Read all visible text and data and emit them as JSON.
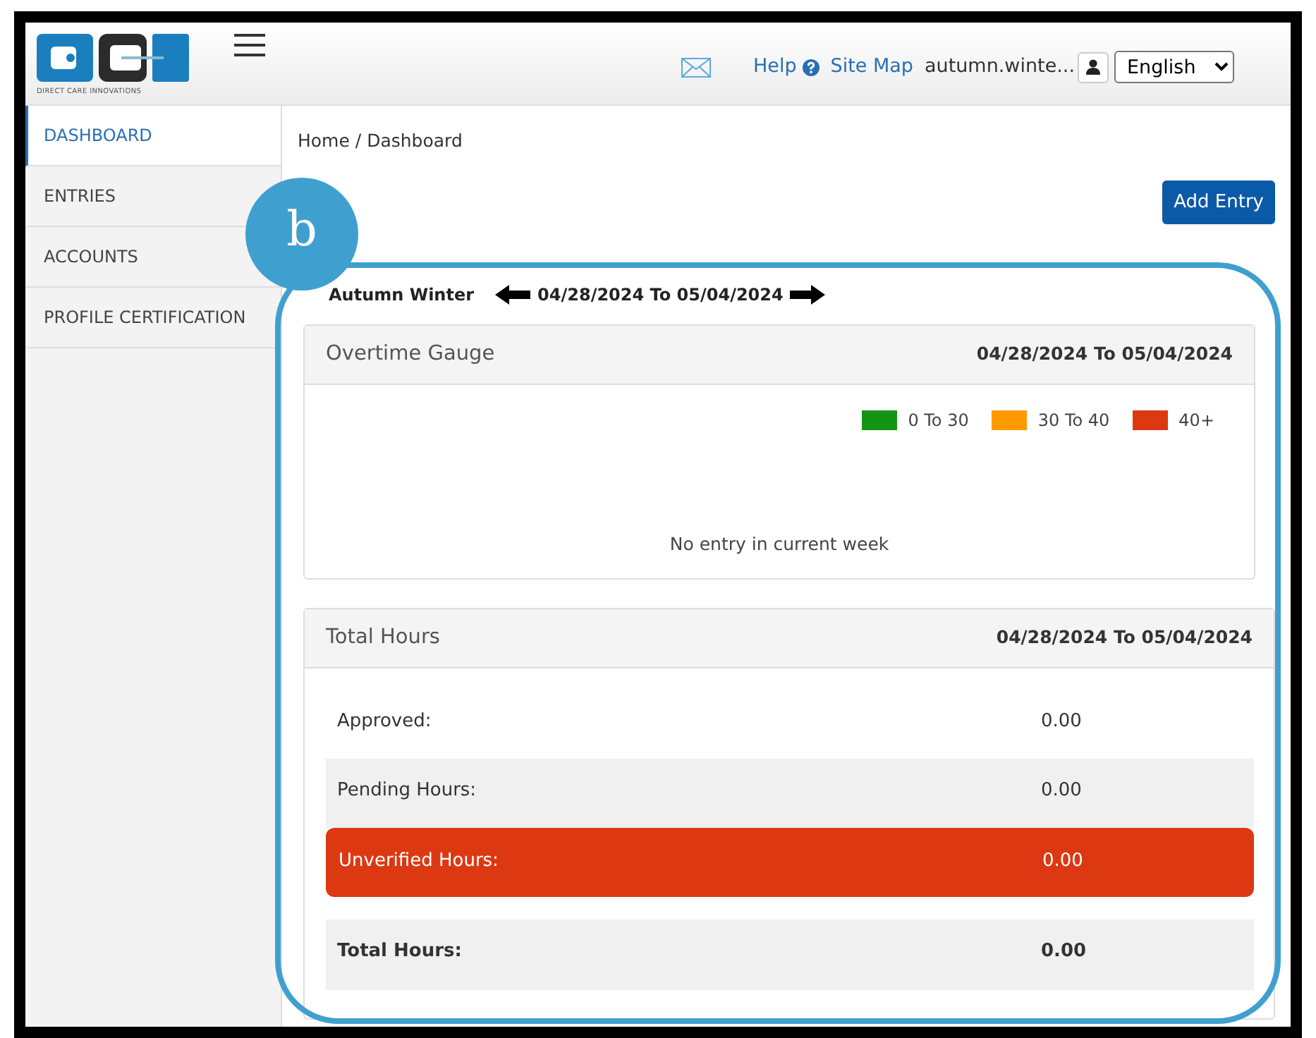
{
  "header": {
    "logo_caption": "DIRECT CARE INNOVATIONS",
    "links": [
      {
        "label": "Help"
      },
      {
        "label": "Site Map"
      }
    ],
    "user": "autumn.winte...",
    "language": {
      "value": "English"
    }
  },
  "sidebar": {
    "items": [
      {
        "label": "DASHBOARD",
        "selected": true
      },
      {
        "label": "ENTRIES",
        "selected": false
      },
      {
        "label": "ACCOUNTS",
        "selected": false
      },
      {
        "label": "PROFILE CERTIFICATION",
        "selected": false
      }
    ]
  },
  "breadcrumb": "Home / Dashboard",
  "add_entry_button": "Add Entry",
  "employee": "Autumn Winter",
  "week_range": "04/28/2024 To 05/04/2024",
  "overtime_gauge": {
    "title": "Overtime Gauge",
    "range": "04/28/2024 To 05/04/2024",
    "legend": [
      {
        "label": "0 To 30",
        "color": "#149414"
      },
      {
        "label": "30 To 40",
        "color": "#ff9900"
      },
      {
        "label": "40+",
        "color": "#dc3913"
      }
    ],
    "message": "No entry in current week"
  },
  "total_hours": {
    "title": "Total Hours",
    "range": "04/28/2024 To 05/04/2024",
    "rows": [
      {
        "kind": "plain",
        "label": "Approved:",
        "value": "0.00"
      },
      {
        "kind": "shaded",
        "label": "Pending Hours:",
        "value": "0.00"
      },
      {
        "kind": "alert",
        "label": "Unverified Hours:",
        "value": "0.00"
      },
      {
        "kind": "total",
        "label": "Total Hours:",
        "value": "0.00"
      }
    ]
  },
  "annotation": {
    "label": "b"
  }
}
